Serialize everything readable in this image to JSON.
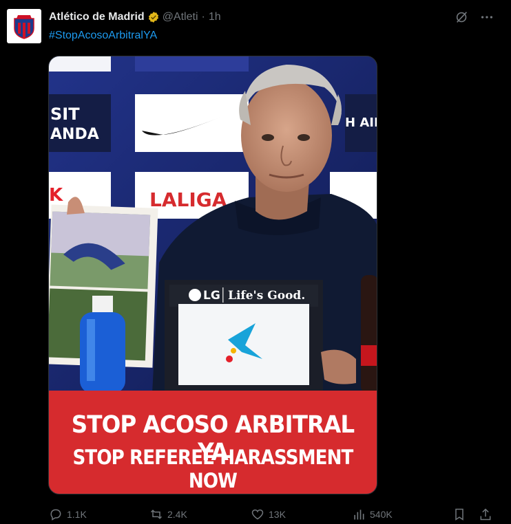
{
  "tweet": {
    "author_name": "Atlético de Madrid",
    "handle": "@Atleti",
    "separator": "·",
    "time": "1h",
    "hashtag": "#StopAcosoArbitralYA"
  },
  "media": {
    "board_sponsor_1": "SIT",
    "board_sponsor_1b": "ANDA",
    "board_brand_right": "H AIR",
    "board_league": "LALIGA",
    "monitor_brand": "LG",
    "monitor_slogan": "Life's Good.",
    "banner_line1": "STOP ACOSO ARBITRAL YA",
    "banner_line2": "STOP REFEREE HARASSMENT NOW",
    "colors": {
      "banner": "#d62b2e",
      "backdrop": "#1a2a6e"
    }
  },
  "actions": {
    "replies": "1.1K",
    "reposts": "2.4K",
    "likes": "13K",
    "views": "540K"
  }
}
